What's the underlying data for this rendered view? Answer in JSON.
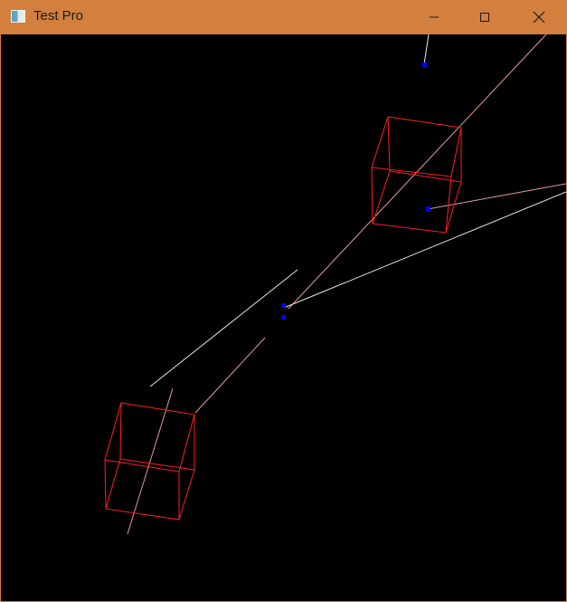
{
  "window": {
    "title": "Test Pro",
    "frame_color": "#d3803f",
    "canvas_color": "#000000",
    "icons": {
      "app": "app-icon",
      "minimize": "minimize-icon",
      "maximize": "maximize-icon",
      "close": "close-icon"
    }
  },
  "scene": {
    "colors": {
      "cube": "#ff1f1f",
      "ray_pink": "#e89a9a",
      "ray_white": "#e6e6e6",
      "marker": "#0000ff"
    }
  }
}
